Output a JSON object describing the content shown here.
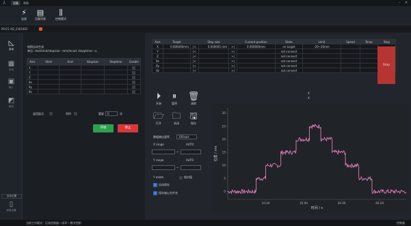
{
  "titlebar": {
    "tabs": [
      "设备",
      "帮助"
    ],
    "window_controls": [
      "-",
      "×"
    ]
  },
  "toolbar": {
    "items": [
      {
        "label": "连接",
        "icon": "plug-icon"
      },
      {
        "label": "设备列表",
        "icon": "list-icon"
      },
      {
        "label": "控制模式",
        "icon": "sliders-icon"
      }
    ]
  },
  "device_tab": {
    "name": "PLY21-4D_2301002"
  },
  "left_nav": {
    "items": [
      {
        "label": "自动",
        "active": true
      },
      {
        "label": "手动",
        "active": false
      },
      {
        "label": "输入",
        "active": false
      },
      {
        "label": "输出",
        "active": false
      }
    ],
    "buttons": [
      "自动位置",
      "参数设置"
    ]
  },
  "sequence": {
    "title": "按照自动生成",
    "unit_hint": "单位: startUmd/stepsize---mm/mcad;  stepptime---s;",
    "columns": [
      "Axis",
      "Start",
      "End",
      "Stepsize",
      "Steptime",
      "Enable"
    ],
    "rows": [
      "X",
      "Y",
      "Z",
      "θx",
      "θy",
      "θz"
    ],
    "return_label": "返回起点",
    "sync_label": "同时",
    "repeat_label": "重复",
    "repeat_value": "0",
    "repeat_unit": "次",
    "start_btn": "开始",
    "stop_btn": "停止"
  },
  "axis_table": {
    "columns": [
      "Axis",
      "Target",
      "",
      "Step size",
      "",
      "Current position",
      "State",
      "Limit",
      "Speed",
      "Temp",
      "Stop"
    ],
    "rows": [
      {
        "axis": "X",
        "target": "0.000000mm",
        "step": "0.000005 mm",
        "position": "0.000000mm",
        "state": "on target",
        "limit": "-20~20mm"
      },
      {
        "axis": "Y",
        "target": "",
        "step": "",
        "position": "",
        "state": "not connect",
        "limit": ""
      },
      {
        "axis": "Z",
        "target": "",
        "step": "",
        "position": "",
        "state": "not connect",
        "limit": ""
      },
      {
        "axis": "θx",
        "target": "",
        "step": "",
        "position": "",
        "state": "not connect",
        "limit": ""
      },
      {
        "axis": "θy",
        "target": "",
        "step": "",
        "position": "",
        "state": "not connect",
        "limit": ""
      },
      {
        "axis": "θz",
        "target": "",
        "step": "",
        "position": "",
        "state": "not connect",
        "limit": ""
      }
    ],
    "stop_label": "Stop"
  },
  "controls": {
    "play": "开始",
    "pause": "暂停",
    "clear": "清除",
    "open": "打开",
    "close": "关闭",
    "save": "保存",
    "selected_axis_top": "X",
    "selected_axis_bottom": "X"
  },
  "plot_settings": {
    "rate_label": "数据输出速率",
    "rate_value": "100sa/s",
    "xrange_label": "X range",
    "xrange_mode": "AUTO",
    "yrange_label": "Y range",
    "yrange_mode": "AUTO",
    "ymode_label": "Y mode",
    "ymode_option": "相对值",
    "autosave": "自动保存",
    "save_first_axis": "保存轴以文件名",
    "range_sep": "~"
  },
  "chart_data": {
    "type": "line",
    "title": "",
    "xlabel": "时间 / s",
    "ylabel": "位置 / nm",
    "xlim": [
      0,
      47
    ],
    "ylim": [
      -3,
      32
    ],
    "xticks": [
      10,
      20,
      30,
      40
    ],
    "xtick_labels": [
      "10.00",
      "20.00",
      "30.00",
      "40.00"
    ],
    "yticks": [
      0,
      5,
      10,
      15,
      20,
      25,
      30
    ],
    "series": [
      {
        "color": "#e47fbf",
        "steps": [
          {
            "x0": 0,
            "x1": 7.5,
            "y": 0
          },
          {
            "x0": 7.5,
            "x1": 10,
            "y": 5
          },
          {
            "x0": 10,
            "x1": 14,
            "y": 10
          },
          {
            "x0": 14,
            "x1": 18,
            "y": 15
          },
          {
            "x0": 18,
            "x1": 21.5,
            "y": 20
          },
          {
            "x0": 21.5,
            "x1": 24.5,
            "y": 25
          },
          {
            "x0": 24.5,
            "x1": 27.5,
            "y": 20
          },
          {
            "x0": 27.5,
            "x1": 31,
            "y": 15
          },
          {
            "x0": 31,
            "x1": 34.5,
            "y": 10
          },
          {
            "x0": 34.5,
            "x1": 38,
            "y": 5
          },
          {
            "x0": 38,
            "x1": 47,
            "y": 0
          }
        ]
      }
    ],
    "grid": false
  },
  "statusbar": {
    "left": "当前工作模式：压电控制器---闭环---数字控制",
    "right": "控制器"
  }
}
